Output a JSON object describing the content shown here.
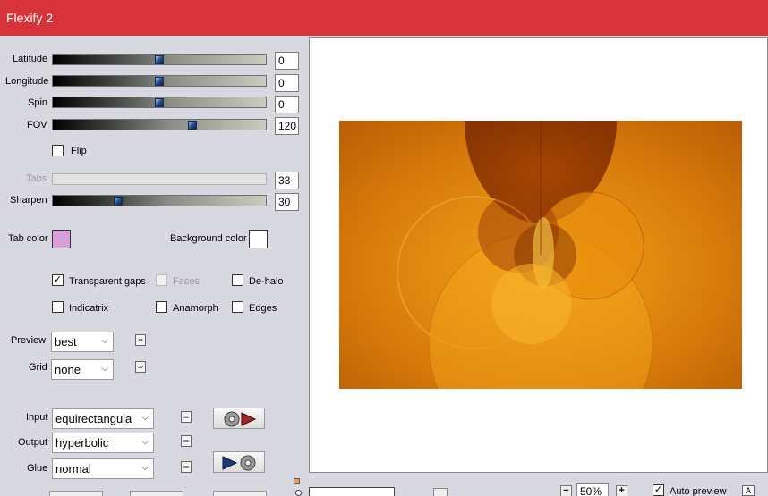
{
  "window": {
    "title": "Flexify 2"
  },
  "sliders": [
    {
      "label": "Latitude",
      "value": "0",
      "position_fraction": 0.5,
      "disabled": false
    },
    {
      "label": "Longitude",
      "value": "0",
      "position_fraction": 0.5,
      "disabled": false
    },
    {
      "label": "Spin",
      "value": "0",
      "position_fraction": 0.5,
      "disabled": false
    },
    {
      "label": "FOV",
      "value": "120",
      "position_fraction": 0.66,
      "disabled": false
    },
    {
      "label": "Tabs",
      "value": "33",
      "position_fraction": null,
      "disabled": true
    },
    {
      "label": "Sharpen",
      "value": "30",
      "position_fraction": 0.3,
      "disabled": false
    }
  ],
  "flip": {
    "label": "Flip",
    "checked": false
  },
  "colors": {
    "tab_color_label": "Tab color",
    "tab_color": "#d8a0d8",
    "background_color_label": "Background color",
    "background_color": "#ffffff"
  },
  "options": {
    "transparent_gaps": {
      "label": "Transparent gaps",
      "checked": true
    },
    "faces": {
      "label": "Faces",
      "checked": false,
      "disabled": true
    },
    "de_halo": {
      "label": "De-halo",
      "checked": false
    },
    "indicatrix": {
      "label": "Indicatrix",
      "checked": false
    },
    "anamorph": {
      "label": "Anamorph",
      "checked": false
    },
    "edges": {
      "label": "Edges",
      "checked": false
    }
  },
  "dropdowns": {
    "preview": {
      "label": "Preview",
      "value": "best"
    },
    "grid": {
      "label": "Grid",
      "value": "none"
    },
    "input": {
      "label": "Input",
      "value": "equirectangula"
    },
    "output": {
      "label": "Output",
      "value": "hyperbolic"
    },
    "glue": {
      "label": "Glue",
      "value": "normal"
    }
  },
  "zoom": {
    "value": "50%",
    "minus": "−",
    "plus": "+"
  },
  "auto_preview": {
    "label": "Auto preview",
    "checked": true
  },
  "accent_colors": {
    "titlebar": "#d8333b",
    "panel": "#d8d8e0",
    "image_primary": "#c96a08"
  }
}
